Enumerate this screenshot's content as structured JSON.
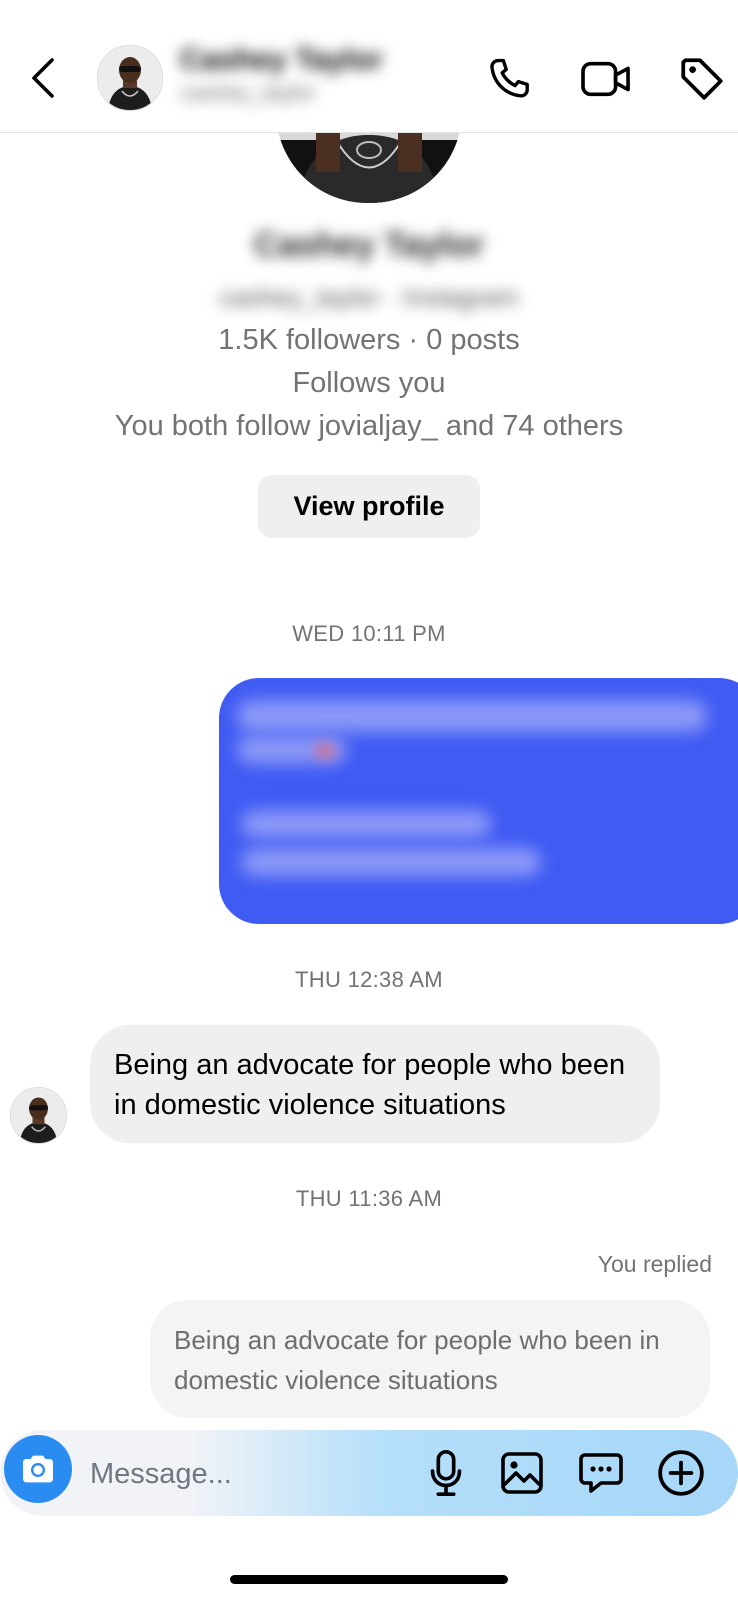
{
  "header": {
    "name": "Cashey Taylor",
    "subtitle": "cashey_taylor"
  },
  "profile": {
    "name": "Cashey Taylor",
    "handle_line": "cashey_taylor · Instagram",
    "stats": "1.5K followers · 0 posts",
    "follows_you": "Follows you",
    "mutual": "You both follow jovialjay_ and 74 others",
    "view_profile_label": "View profile"
  },
  "messages": {
    "timestamp_1": "WED 10:11 PM",
    "timestamp_2": "THU 12:38 AM",
    "received_text": "Being an advocate for people who been in domestic violence situations",
    "timestamp_3": "THU 11:36 AM",
    "you_replied_label": "You replied",
    "reply_quote_text": "Being an advocate for people who been in domestic violence situations"
  },
  "composer": {
    "placeholder": "Message..."
  },
  "icons": {
    "back": "chevron-left-icon",
    "call": "phone-icon",
    "video": "video-camera-icon",
    "tag": "tag-icon",
    "camera": "camera-icon",
    "mic": "microphone-icon",
    "gallery": "image-icon",
    "sticker": "chat-bubble-icon",
    "more": "plus-circle-icon"
  },
  "colors": {
    "sent_bubble": "#3f5bf3",
    "camera_button": "#2a8cf1",
    "received_bubble": "#efefef"
  }
}
